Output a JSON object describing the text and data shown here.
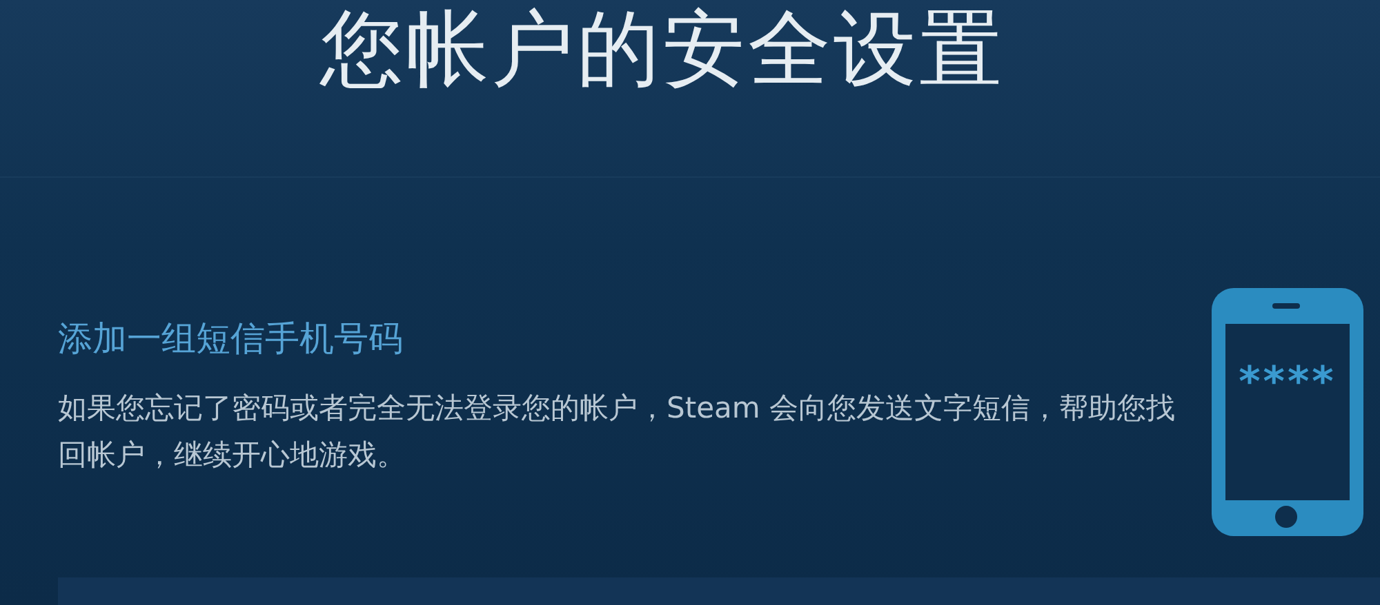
{
  "title": "您帐户的安全设置",
  "section": {
    "heading": "添加一组短信手机号码",
    "description": "如果您忘记了密码或者完全无法登录您的帐户，Steam 会向您发送文字短信，帮助您找回帐户，继续开心地游戏。",
    "phone_screen_text": "****"
  }
}
